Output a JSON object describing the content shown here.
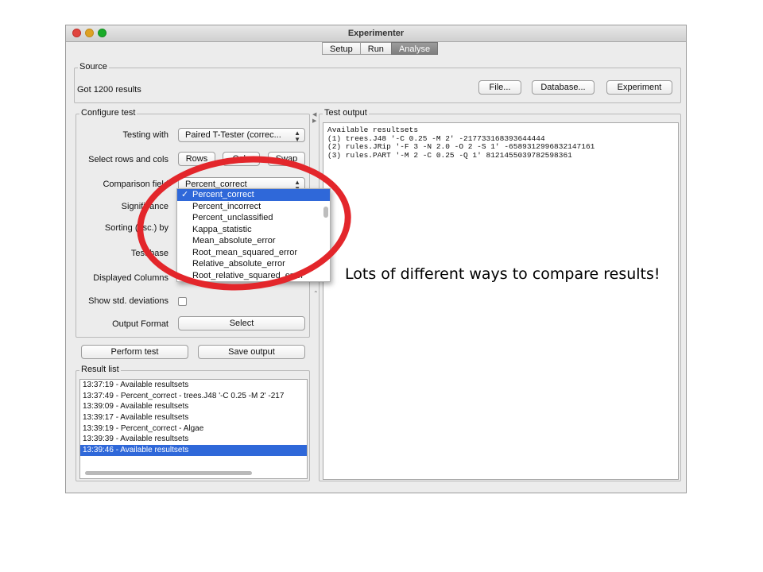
{
  "window": {
    "title": "Experimenter",
    "traffic_lights": {
      "close": "#e0443e",
      "minimize": "#dea123",
      "zoom": "#1aab29"
    },
    "tabs": [
      {
        "label": "Setup",
        "active": false
      },
      {
        "label": "Run",
        "active": false
      },
      {
        "label": "Analyse",
        "active": true
      }
    ]
  },
  "source": {
    "legend": "Source",
    "status": "Got 1200 results",
    "buttons": {
      "file": "File...",
      "database": "Database...",
      "experiment": "Experiment"
    }
  },
  "configure": {
    "legend": "Configure test",
    "testing_with_label": "Testing with",
    "testing_with_value": "Paired T-Tester (correc...",
    "select_rows_cols_label": "Select rows and cols",
    "rows_button": "Rows",
    "cols_button": "Cols",
    "swap_button": "Swap",
    "comparison_field_label": "Comparison field",
    "comparison_field_value": "Percent_correct",
    "significance_label": "Significance",
    "sorting_label": "Sorting (asc.) by",
    "test_base_label": "Test base",
    "displayed_columns_label": "Displayed Columns",
    "show_std_label": "Show std. deviations",
    "output_format_label": "Output Format",
    "output_format_button": "Select"
  },
  "dropdown": {
    "options": [
      "Percent_correct",
      "Percent_incorrect",
      "Percent_unclassified",
      "Kappa_statistic",
      "Mean_absolute_error",
      "Root_mean_squared_error",
      "Relative_absolute_error",
      "Root_relative_squared_error"
    ],
    "selected_index": 0,
    "check_mark": "✓"
  },
  "actions": {
    "perform_test": "Perform test",
    "save_output": "Save output"
  },
  "result_list": {
    "legend": "Result list",
    "items": [
      "13:37:19 - Available resultsets",
      "13:37:49 - Percent_correct - trees.J48 '-C 0.25 -M 2' -217",
      "13:39:09 - Available resultsets",
      "13:39:17 - Available resultsets",
      "13:39:19 - Percent_correct - Algae",
      "13:39:39 - Available resultsets",
      "13:39:46 - Available resultsets"
    ],
    "selected_index": 6
  },
  "test_output": {
    "legend": "Test output",
    "lines": [
      "Available resultsets",
      "(1) trees.J48 '-C 0.25 -M 2' -217733168393644444",
      "(2) rules.JRip '-F 3 -N 2.0 -O 2 -S 1' -6589312996832147161",
      "(3) rules.PART '-M 2 -C 0.25 -Q 1' 8121455039782598361"
    ]
  },
  "annotation": {
    "caption": "Lots of different ways to compare results!",
    "ellipse_color": "#e3262b"
  }
}
